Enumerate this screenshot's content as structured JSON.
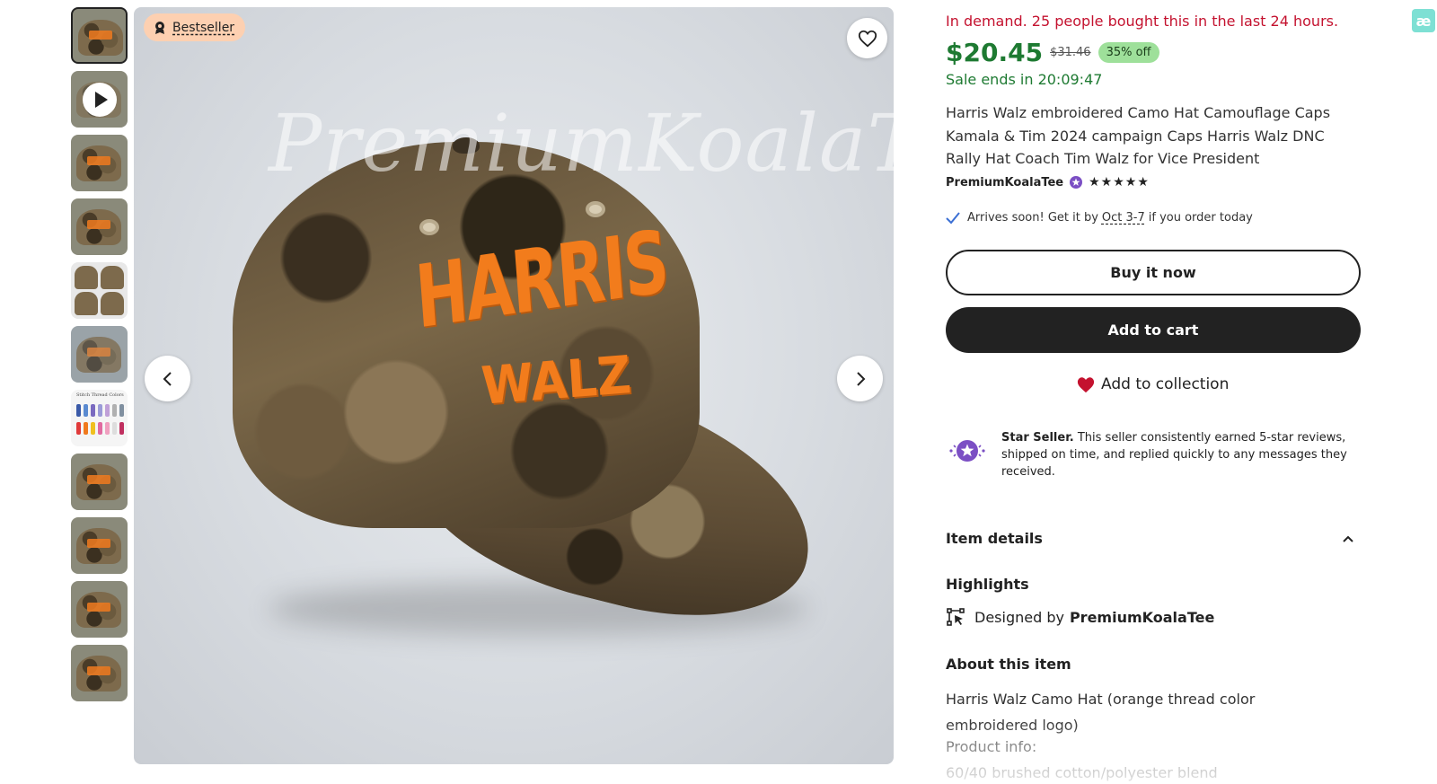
{
  "listing": {
    "badge_label": "Bestseller",
    "watermark": "PremiumKoalaTee",
    "hat_text_line1": "HARRIS",
    "hat_text_line2": "WALZ",
    "thumbnail_count": 11
  },
  "purchase": {
    "demand_text": "In demand. 25 people bought this in the last 24 hours.",
    "price": "$20.45",
    "original_price": "$31.46",
    "discount": "35% off",
    "sale_ends": "Sale ends in 20:09:47",
    "title": "Harris Walz embroidered Camo Hat Camouflage Caps Kamala & Tim 2024 campaign Caps Harris Walz DNC Rally Hat Coach Tim Walz for Vice President",
    "shop_name": "PremiumKoalaTee",
    "rating_stars": "★★★★★",
    "delivery_prefix": "Arrives soon! Get it by",
    "delivery_date": "Oct 3-7",
    "delivery_suffix": "if you order today",
    "buy_now_label": "Buy it now",
    "add_to_cart_label": "Add to cart",
    "add_to_collection_label": "Add to collection"
  },
  "star_seller": {
    "title": "Star Seller.",
    "text": "This seller consistently earned 5-star reviews, shipped on time, and replied quickly to any messages they received."
  },
  "details": {
    "section_label": "Item details",
    "highlights_label": "Highlights",
    "designed_by_prefix": "Designed by",
    "designed_by_name": "PremiumKoalaTee",
    "about_label": "About this item",
    "desc_line1": "Harris Walz Camo Hat (orange thread color embroidered logo)",
    "desc_line2": "Product info:",
    "desc_line3": "60/40 brushed cotton/polyester blend"
  },
  "extension": {
    "label": "æ"
  },
  "colors": {
    "price_green": "#1e7a32",
    "demand_red": "#c4122f",
    "badge_bg": "#fdd0b1",
    "discount_bg": "#9ee09a",
    "heart_red": "#c4122f",
    "star_seller_purple": "#7b4fc4"
  }
}
